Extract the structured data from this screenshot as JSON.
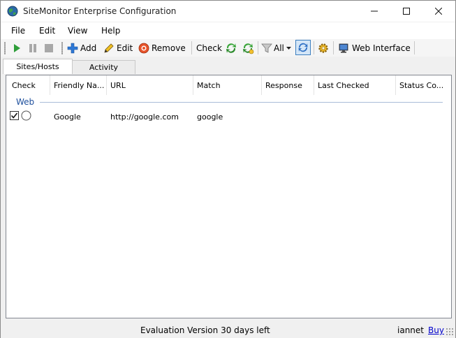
{
  "window": {
    "title": "SiteMonitor Enterprise Configuration"
  },
  "menu": [
    "File",
    "Edit",
    "View",
    "Help"
  ],
  "toolbar": {
    "add": "Add",
    "edit": "Edit",
    "remove": "Remove",
    "check": "Check",
    "filter": "All",
    "web_interface": "Web Interface"
  },
  "tabs": [
    "Sites/Hosts",
    "Activity"
  ],
  "table": {
    "columns": [
      "Check",
      "Friendly Na...",
      "URL",
      "Match",
      "Response",
      "Last Checked",
      "Status Co..."
    ],
    "group": "Web",
    "rows": [
      {
        "checked": true,
        "friendly_name": "Google",
        "url": "http://google.com",
        "match": "google",
        "response": "",
        "last_checked": "",
        "status_code": ""
      }
    ]
  },
  "status": {
    "text": "Evaluation Version 30 days left",
    "user": "iannet",
    "buy": "Buy"
  },
  "colors": {
    "accent": "#1e4f9c",
    "link": "#0000cc",
    "play": "#2f9e3a"
  }
}
